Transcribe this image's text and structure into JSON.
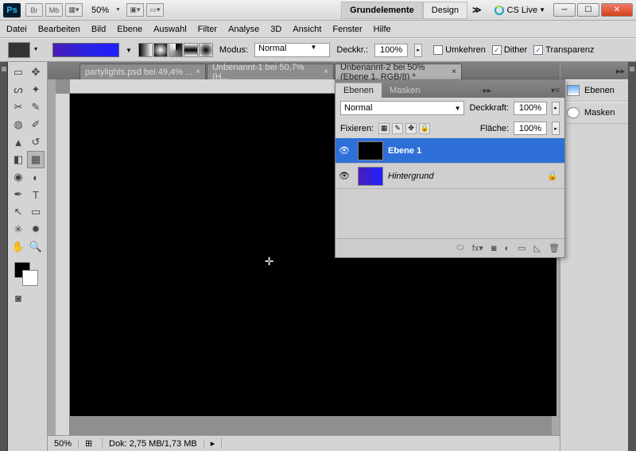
{
  "titlebar": {
    "ps": "Ps",
    "br": "Br",
    "mb": "Mb",
    "zoom": "50%",
    "workspaces": {
      "grundelemente": "Grundelemente",
      "design": "Design",
      "more": "≫"
    },
    "cslive": "CS Live"
  },
  "menu": [
    "Datei",
    "Bearbeiten",
    "Bild",
    "Ebene",
    "Auswahl",
    "Filter",
    "Analyse",
    "3D",
    "Ansicht",
    "Fenster",
    "Hilfe"
  ],
  "options": {
    "modus_label": "Modus:",
    "modus_value": "Normal",
    "deckkr_label": "Deckkr.:",
    "deckkr_value": "100%",
    "umkehren": "Umkehren",
    "dither": "Dither",
    "transparenz": "Transparenz"
  },
  "tabs": [
    {
      "label": "partylights.psd bei 49,4% ...",
      "active": false
    },
    {
      "label": "Unbenannt-1 bei 50,7% (H...",
      "active": false
    },
    {
      "label": "Unbenannt-2 bei 50% (Ebene 1, RGB/8) *",
      "active": true
    }
  ],
  "panel": {
    "ebenen": "Ebenen",
    "masken": "Masken",
    "blend": "Normal",
    "deckkraft_label": "Deckkraft:",
    "deckkraft_value": "100%",
    "fixieren": "Fixieren:",
    "flaeche_label": "Fläche:",
    "flaeche_value": "100%",
    "layers": [
      {
        "name": "Ebene 1",
        "thumb": "#000000",
        "selected": true,
        "locked": false,
        "italic": false
      },
      {
        "name": "Hintergrund",
        "thumb": "linear-gradient(90deg,#4a1db8,#2020ff)",
        "selected": false,
        "locked": true,
        "italic": true
      }
    ]
  },
  "rightpanels": {
    "ebenen": "Ebenen",
    "masken": "Masken"
  },
  "status": {
    "zoom": "50%",
    "doc": "Dok: 2,75 MB/1,73 MB"
  }
}
